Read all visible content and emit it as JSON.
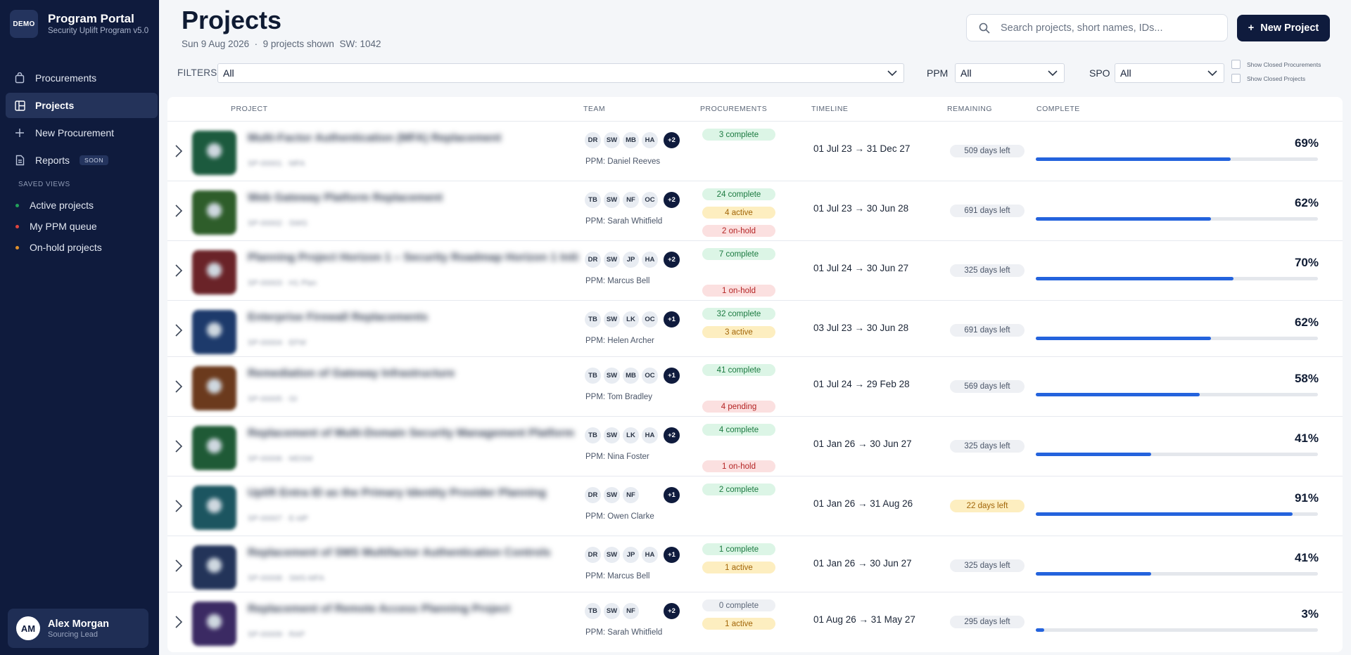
{
  "app": {
    "logo_text": "DEMO",
    "title": "Program Portal",
    "subtitle": "Security Uplift Program v5.0"
  },
  "nav": [
    {
      "label": "Procurements",
      "icon": "bag-icon"
    },
    {
      "label": "Projects",
      "icon": "grid-icon",
      "active": true
    },
    {
      "label": "New Procurement",
      "icon": "plus-icon"
    },
    {
      "label": "Reports",
      "icon": "document-icon",
      "badge": "SOON"
    }
  ],
  "saved_views": {
    "label": "SAVED VIEWS",
    "items": [
      {
        "label": "Active projects",
        "color": "#22a05a"
      },
      {
        "label": "My PPM queue",
        "color": "#e0443e"
      },
      {
        "label": "On-hold projects",
        "color": "#e0902b"
      }
    ]
  },
  "user": {
    "initials": "AM",
    "name": "Alex Morgan",
    "role": "Sourcing Lead"
  },
  "header": {
    "title": "Projects",
    "date": "Sun 9 Aug 2026",
    "shown": "9 projects shown",
    "sw": "SW: 1042",
    "search_placeholder": "Search projects, short names, IDs...",
    "new_button": "New Project"
  },
  "filters": {
    "label": "FILTERS",
    "main_value": "All",
    "ppm_label": "PPM",
    "ppm_value": "All",
    "spo_label": "SPO",
    "spo_value": "All",
    "show_closed_procurements": "Show Closed Procurements",
    "show_closed_projects": "Show Closed Projects"
  },
  "columns": [
    "PROJECT",
    "TEAM",
    "PROCUREMENTS",
    "TIMELINE",
    "REMAINING",
    "COMPLETE"
  ],
  "colors": {
    "accent": "#2463dd",
    "sidebar": "#0f1b3d"
  },
  "projects": [
    {
      "name": "Multi-Factor Authentication (MFA) Replacement",
      "sub": "SP-00001 · MFA",
      "thumb": "#1c5a3e",
      "team": [
        "DR",
        "SW",
        "MB",
        "HA"
      ],
      "more": "+2",
      "ppm": "PPM: Daniel Reeves",
      "procurements": [
        {
          "text": "3 complete",
          "kind": "complete",
          "slot": 0
        }
      ],
      "timeline": "01 Jul 23 → 31 Dec 27",
      "remaining": "509 days left",
      "warn": false,
      "complete": 69,
      "complete_label": "69%"
    },
    {
      "name": "Web Gateway Platform Replacement",
      "sub": "SP-00002 · SWG",
      "thumb": "#2e5d2a",
      "team": [
        "TB",
        "SW",
        "NF",
        "OC"
      ],
      "more": "+2",
      "ppm": "PPM: Sarah Whitfield",
      "procurements": [
        {
          "text": "24 complete",
          "kind": "complete",
          "slot": 0
        },
        {
          "text": "4 active",
          "kind": "active",
          "slot": 1
        },
        {
          "text": "2 on-hold",
          "kind": "hold",
          "slot": 2
        }
      ],
      "timeline": "01 Jul 23 → 30 Jun 28",
      "remaining": "691 days left",
      "warn": false,
      "complete": 62,
      "complete_label": "62%"
    },
    {
      "name": "Planning Project Horizon 1 – Security Roadmap Horizon 1 Initiatives",
      "sub": "SP-00003 · H1 Plan",
      "thumb": "#6a2328",
      "team": [
        "DR",
        "SW",
        "JP",
        "HA"
      ],
      "more": "+2",
      "ppm": "PPM: Marcus Bell",
      "procurements": [
        {
          "text": "7 complete",
          "kind": "complete",
          "slot": 0
        },
        {
          "text": "1 on-hold",
          "kind": "hold",
          "slot": 2
        }
      ],
      "timeline": "01 Jul 24 → 30 Jun 27",
      "remaining": "325 days left",
      "warn": false,
      "complete": 70,
      "complete_label": "70%"
    },
    {
      "name": "Enterprise Firewall Replacements",
      "sub": "SP-00004 · EFW",
      "thumb": "#1d3a6b",
      "team": [
        "TB",
        "SW",
        "LK",
        "OC"
      ],
      "more": "+1",
      "ppm": "PPM: Helen Archer",
      "procurements": [
        {
          "text": "32 complete",
          "kind": "complete",
          "slot": 0
        },
        {
          "text": "3 active",
          "kind": "active",
          "slot": 1
        }
      ],
      "timeline": "03 Jul 23 → 30 Jun 28",
      "remaining": "691 days left",
      "warn": false,
      "complete": 62,
      "complete_label": "62%"
    },
    {
      "name": "Remediation of Gateway Infrastructure",
      "sub": "SP-00005 · GI",
      "thumb": "#6b3a1d",
      "team": [
        "TB",
        "SW",
        "MB",
        "OC"
      ],
      "more": "+1",
      "ppm": "PPM: Tom Bradley",
      "procurements": [
        {
          "text": "41 complete",
          "kind": "complete",
          "slot": 0
        },
        {
          "text": "4 pending",
          "kind": "pending",
          "slot": 2
        }
      ],
      "timeline": "01 Jul 24 → 29 Feb 28",
      "remaining": "569 days left",
      "warn": false,
      "complete": 58,
      "complete_label": "58%"
    },
    {
      "name": "Replacement of Multi-Domain Security Management Platform",
      "sub": "SP-00006 · MDSM",
      "thumb": "#1f5a36",
      "team": [
        "TB",
        "SW",
        "LK",
        "HA"
      ],
      "more": "+2",
      "ppm": "PPM: Nina Foster",
      "procurements": [
        {
          "text": "4 complete",
          "kind": "complete",
          "slot": 0
        },
        {
          "text": "1 on-hold",
          "kind": "hold",
          "slot": 2
        }
      ],
      "timeline": "01 Jan 26 → 30 Jun 27",
      "remaining": "325 days left",
      "warn": false,
      "complete": 41,
      "complete_label": "41%"
    },
    {
      "name": "Uplift Entra ID as the Primary Identity Provider Planning",
      "sub": "SP-00007 · E-IdP",
      "thumb": "#1c5560",
      "team": [
        "DR",
        "SW",
        "NF"
      ],
      "more": "+1",
      "ppm": "PPM: Owen Clarke",
      "procurements": [
        {
          "text": "2 complete",
          "kind": "complete",
          "slot": 0
        }
      ],
      "timeline": "01 Jan 26 → 31 Aug 26",
      "remaining": "22 days left",
      "warn": true,
      "complete": 91,
      "complete_label": "91%"
    },
    {
      "name": "Replacement of SMS Multifactor Authentication Controls",
      "sub": "SP-00008 · SMS-MFA",
      "thumb": "#233459",
      "team": [
        "DR",
        "SW",
        "JP",
        "HA"
      ],
      "more": "+1",
      "ppm": "PPM: Marcus Bell",
      "procurements": [
        {
          "text": "1 complete",
          "kind": "complete",
          "slot": 0
        },
        {
          "text": "1 active",
          "kind": "active",
          "slot": 1
        }
      ],
      "timeline": "01 Jan 26 → 30 Jun 27",
      "remaining": "325 days left",
      "warn": false,
      "complete": 41,
      "complete_label": "41%"
    },
    {
      "name": "Replacement of Remote Access Planning Project",
      "sub": "SP-00009 · RAP",
      "thumb": "#3b2a63",
      "team": [
        "TB",
        "SW",
        "NF"
      ],
      "more": "+2",
      "ppm": "PPM: Sarah Whitfield",
      "procurements": [
        {
          "text": "0 complete",
          "kind": "zero",
          "slot": 0
        },
        {
          "text": "1 active",
          "kind": "active",
          "slot": 1
        }
      ],
      "timeline": "01 Aug 26 → 31 May 27",
      "remaining": "295 days left",
      "warn": false,
      "complete": 3,
      "complete_label": "3%"
    }
  ]
}
